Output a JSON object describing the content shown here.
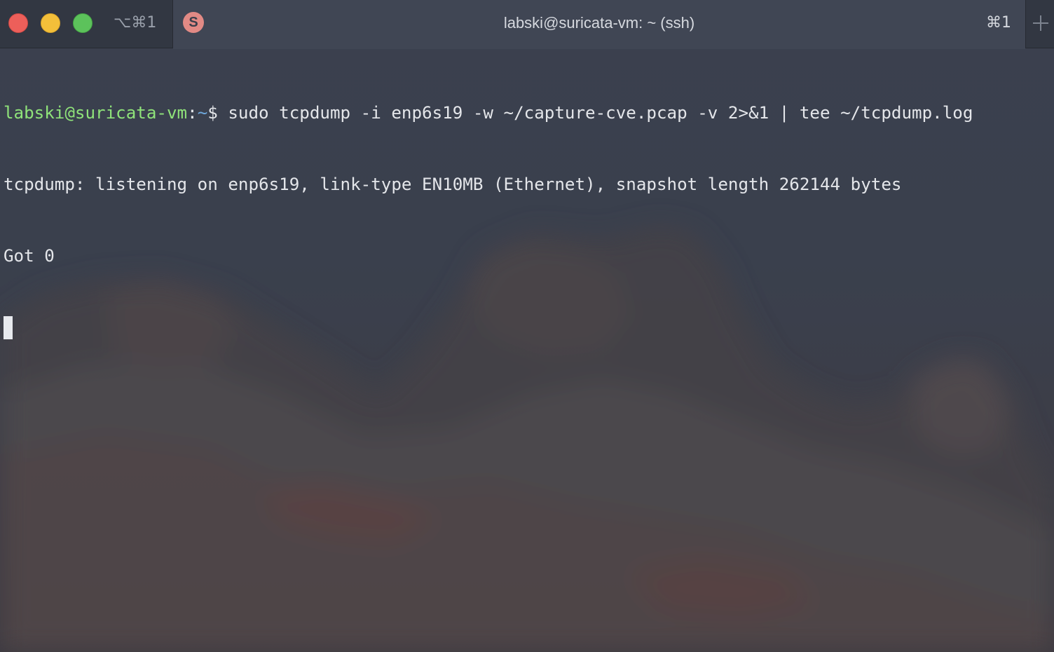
{
  "window": {
    "tab_shortcut_left": "⌥⌘1",
    "app_icon_letter": "S",
    "title": "labski@suricata-vm: ~ (ssh)",
    "tab_shortcut_right": "⌘1",
    "new_tab_icon": "plus-icon"
  },
  "terminal": {
    "prompt": {
      "user_host": "labski@suricata-vm",
      "colon": ":",
      "path": "~",
      "symbol": "$ "
    },
    "command": "sudo tcpdump -i enp6s19 -w ~/capture-cve.pcap -v 2>&1 | tee ~/tcpdump.log",
    "output": [
      "tcpdump: listening on enp6s19, link-type EN10MB (Ethernet), snapshot length 262144 bytes",
      "Got 0"
    ]
  },
  "colors": {
    "prompt_user": "#8fe37a",
    "prompt_path": "#6fa8dc",
    "text": "#e4e6ea",
    "close": "#ed5f5a",
    "minimize": "#f3bf3a",
    "maximize": "#5cc25b",
    "app_icon": "#e28a85"
  }
}
